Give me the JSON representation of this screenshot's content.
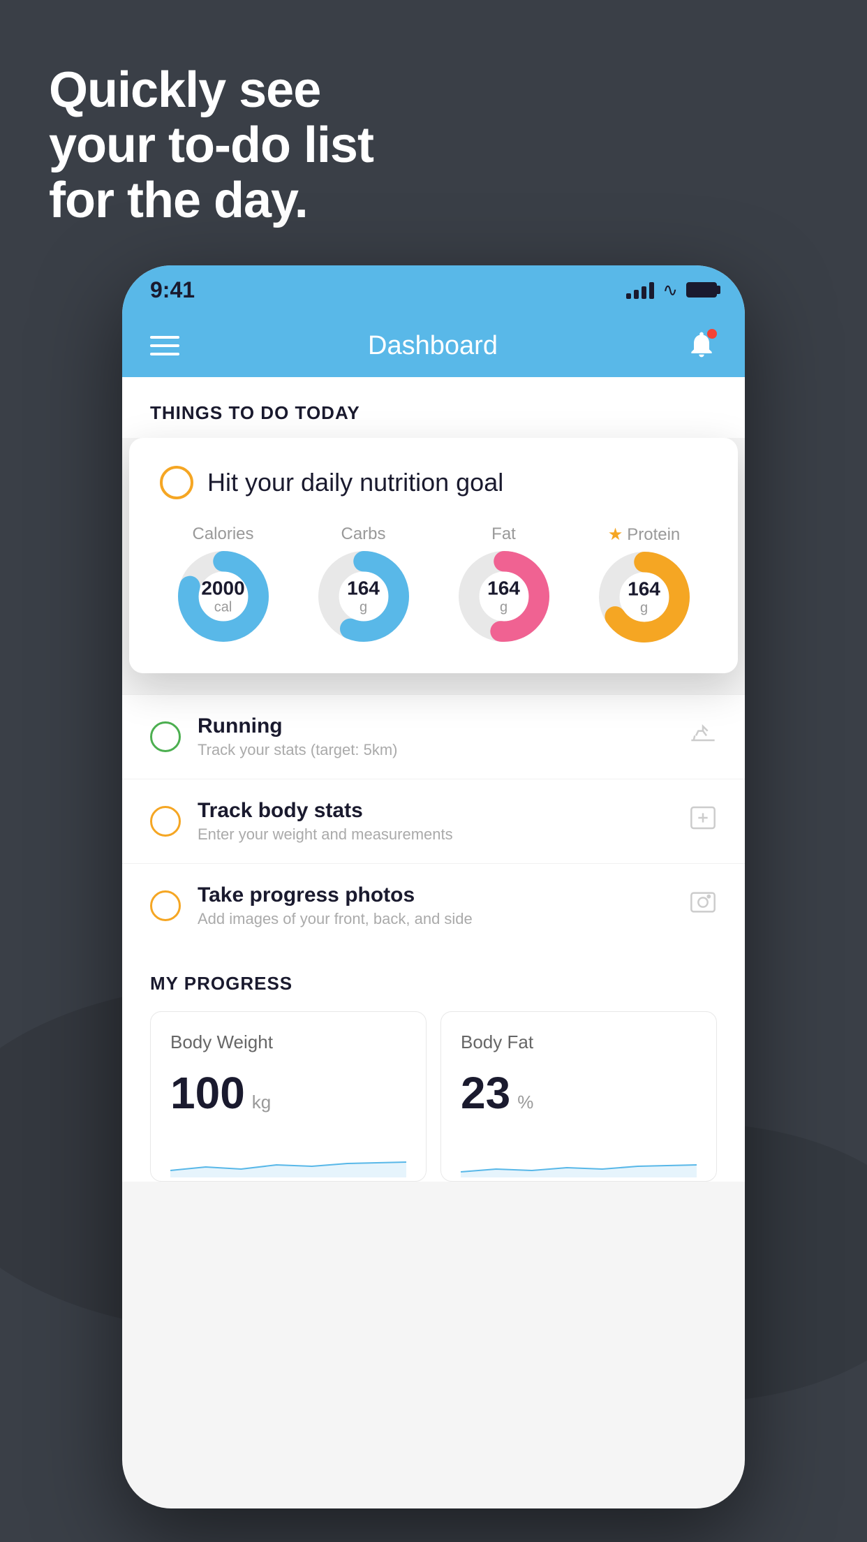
{
  "background": {
    "color": "#3a3f47"
  },
  "headline": {
    "line1": "Quickly see",
    "line2": "your to-do list",
    "line3": "for the day."
  },
  "phone": {
    "status_bar": {
      "time": "9:41"
    },
    "header": {
      "title": "Dashboard"
    },
    "things_section": {
      "title": "THINGS TO DO TODAY"
    },
    "nutrition_card": {
      "title": "Hit your daily nutrition goal",
      "stats": [
        {
          "label": "Calories",
          "value": "2000",
          "unit": "cal",
          "color": "blue",
          "star": false
        },
        {
          "label": "Carbs",
          "value": "164",
          "unit": "g",
          "color": "blue",
          "star": false
        },
        {
          "label": "Fat",
          "value": "164",
          "unit": "g",
          "color": "pink",
          "star": false
        },
        {
          "label": "Protein",
          "value": "164",
          "unit": "g",
          "color": "gold",
          "star": true
        }
      ]
    },
    "todo_items": [
      {
        "name": "Running",
        "desc": "Track your stats (target: 5km)",
        "circle_color": "green",
        "icon": "shoe"
      },
      {
        "name": "Track body stats",
        "desc": "Enter your weight and measurements",
        "circle_color": "yellow",
        "icon": "scale"
      },
      {
        "name": "Take progress photos",
        "desc": "Add images of your front, back, and side",
        "circle_color": "yellow",
        "icon": "photo"
      }
    ],
    "progress_section": {
      "title": "MY PROGRESS",
      "cards": [
        {
          "title": "Body Weight",
          "value": "100",
          "unit": "kg"
        },
        {
          "title": "Body Fat",
          "value": "23",
          "unit": "%"
        }
      ]
    }
  }
}
